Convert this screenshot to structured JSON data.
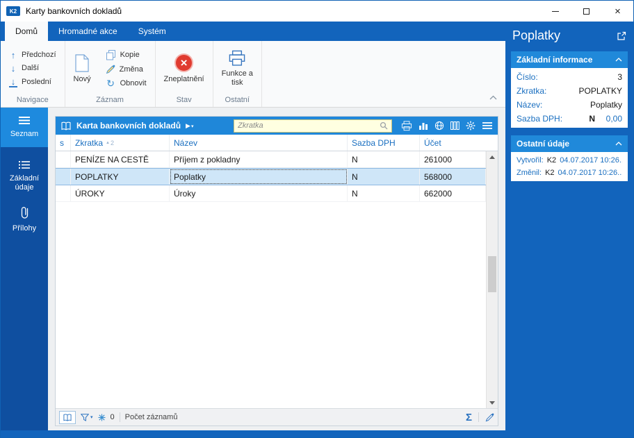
{
  "colors": {
    "frame": "#1264bc",
    "accent": "#1f87d9",
    "sidebar": "#0f4fa0",
    "selected_row": "#cfe6f8",
    "label_blue": "#1a6fc0",
    "search_bg": "#ffffe1",
    "danger": "#e03b30"
  },
  "window": {
    "title": "Karty bankovních dokladů",
    "badge": "K2"
  },
  "tabs": [
    {
      "label": "Domů"
    },
    {
      "label": "Hromadné akce"
    },
    {
      "label": "Systém"
    }
  ],
  "ribbon": {
    "navigace": {
      "label": "Navigace",
      "prev": "Předchozí",
      "next": "Další",
      "last": "Poslední"
    },
    "zaznam": {
      "label": "Záznam",
      "new": "Nový",
      "copy": "Kopie",
      "change": "Změna",
      "refresh": "Obnovit"
    },
    "stav": {
      "label": "Stav",
      "invalidate": "Zneplatnění"
    },
    "ostatni": {
      "label": "Ostatní",
      "print_line1": "Funkce a",
      "print_line2": "tisk"
    }
  },
  "sidebar": {
    "seznam": "Seznam",
    "zakladni": "Základní údaje",
    "prilohy": "Přílohy"
  },
  "grid": {
    "title": "Karta bankovních dokladů",
    "search_placeholder": "Zkratka",
    "columns": {
      "s": "s",
      "zkratka": "Zkratka",
      "nazev": "Název",
      "dph": "Sazba DPH",
      "ucet": "Účet"
    },
    "sort_order": "2",
    "rows": [
      {
        "zkratka": "PENÍZE NA CESTĚ",
        "nazev": "Příjem z pokladny",
        "dph": "N",
        "ucet": "261000"
      },
      {
        "zkratka": "POPLATKY",
        "nazev": "Poplatky",
        "dph": "N",
        "ucet": "568000"
      },
      {
        "zkratka": "ÚROKY",
        "nazev": "Úroky",
        "dph": "N",
        "ucet": "662000"
      }
    ],
    "status": {
      "count": "0",
      "records": "Počet záznamů"
    }
  },
  "panel": {
    "title": "Poplatky",
    "basic": {
      "title": "Základní informace",
      "cislo_label": "Číslo:",
      "cislo": "3",
      "zkratka_label": "Zkratka:",
      "zkratka": "POPLATKY",
      "nazev_label": "Název:",
      "nazev": "Poplatky",
      "dph_label": "Sazba DPH:",
      "dph": "N",
      "dph2": "0,00"
    },
    "other": {
      "title": "Ostatní údaje",
      "created_label": "Vytvořil:",
      "created_by": "K2",
      "created_at": "04.07.2017 10:26...",
      "changed_label": "Změnil:",
      "changed_by": "K2",
      "changed_at": "04.07.2017 10:26..."
    }
  }
}
